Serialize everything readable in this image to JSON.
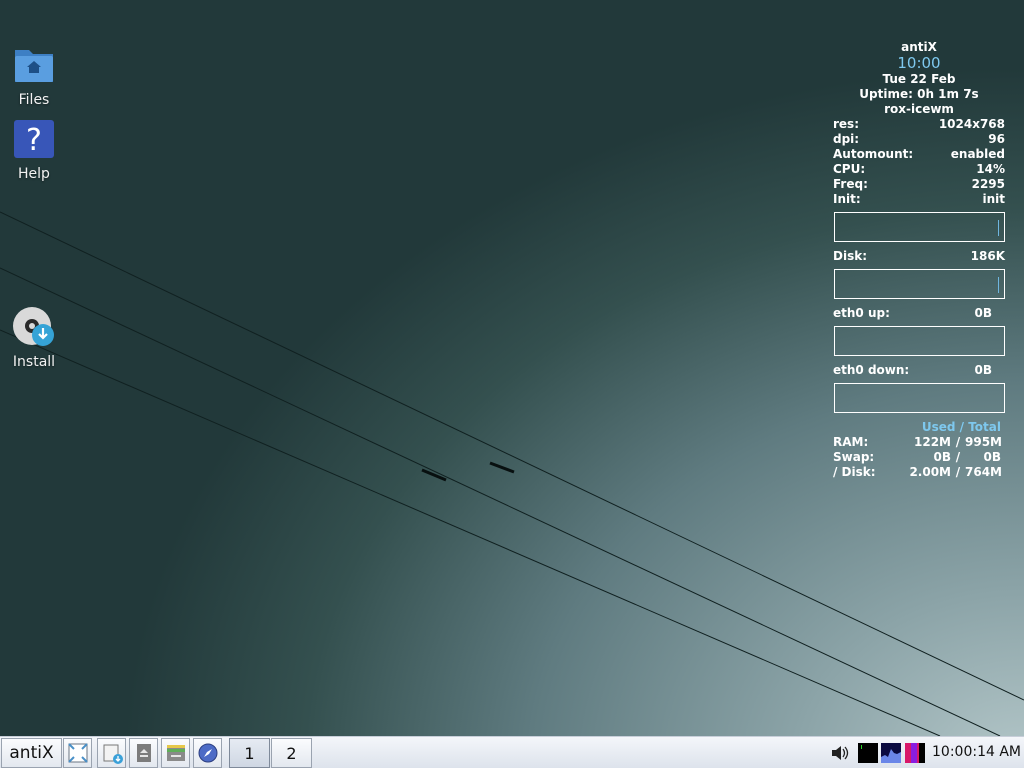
{
  "desktop": {
    "icons": [
      {
        "label": "Files",
        "icon": "folder-home-icon"
      },
      {
        "label": "Help",
        "icon": "help-icon"
      },
      {
        "label": "Install",
        "icon": "install-disc-icon"
      }
    ]
  },
  "conky": {
    "distro": "antiX",
    "time": "10:00",
    "date": "Tue 22 Feb",
    "uptime": "Uptime: 0h 1m 7s",
    "session": "rox-icewm",
    "stats": [
      {
        "key": "res:",
        "value": "1024x768"
      },
      {
        "key": "dpi:",
        "value": "96"
      },
      {
        "key": "Automount:",
        "value": "enabled"
      },
      {
        "key": "CPU:",
        "value": "14%"
      },
      {
        "key": "Freq:",
        "value": "2295"
      },
      {
        "key": "Init:",
        "value": "init"
      }
    ],
    "disk": {
      "key": "Disk:",
      "value": "186K"
    },
    "eth_up": {
      "key": "eth0 up:",
      "value": "0B"
    },
    "eth_down": {
      "key": "eth0 down:",
      "value": "0B"
    },
    "mem_header": "Used / Total",
    "mem": [
      {
        "key": "RAM:",
        "used": "122M",
        "total": "995M"
      },
      {
        "key": "Swap:",
        "used": "0B",
        "total": "0B"
      },
      {
        "key": "/ Disk:",
        "used": "2.00M",
        "total": "764M"
      }
    ],
    "accent": "#7ec8ee"
  },
  "taskbar": {
    "start_label": "antiX",
    "quick_launch": [
      "show-desktop-icon",
      "file-manager-icon",
      "eject-icon",
      "control-centre-icon",
      "browser-icon"
    ],
    "workspaces": [
      "1",
      "2"
    ],
    "active_workspace": "1",
    "tray": [
      "volume-icon",
      "network-monitor-icon",
      "cpu-monitor-icon",
      "memory-monitor-icon"
    ],
    "clock": "10:00:14 AM"
  }
}
